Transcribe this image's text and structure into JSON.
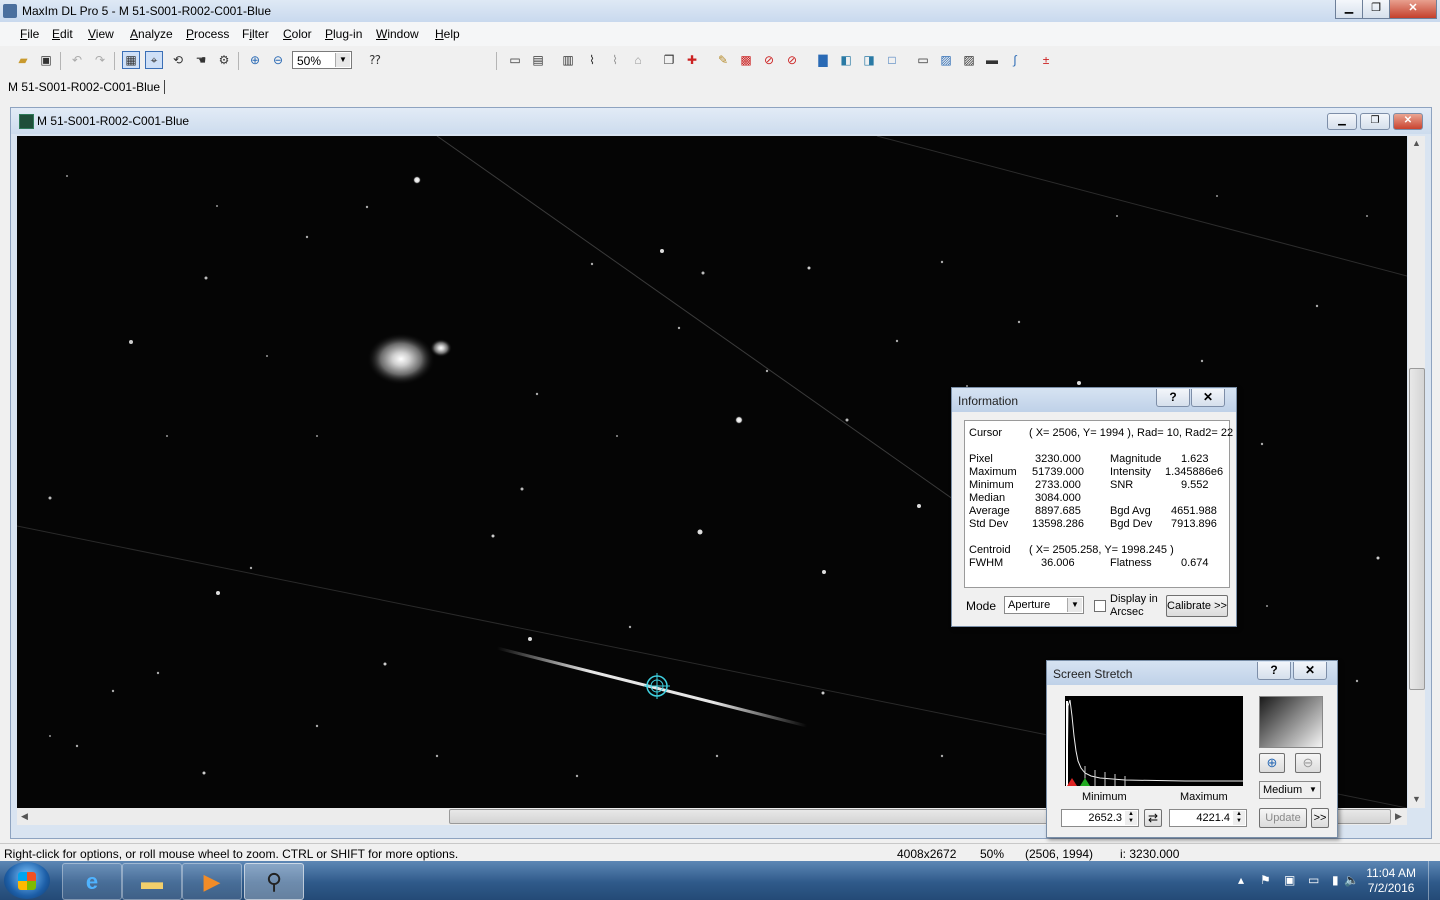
{
  "app": {
    "title": "MaxIm DL Pro 5 - M 51-S001-R002-C001-Blue"
  },
  "menu": [
    "File",
    "Edit",
    "View",
    "Analyze",
    "Process",
    "Filter",
    "Color",
    "Plug-in",
    "Window",
    "Help"
  ],
  "menu_mnemonics": [
    "F",
    "E",
    "V",
    "A",
    "P",
    "i",
    "C",
    "P",
    "W",
    "H"
  ],
  "toolbar": {
    "zoom_value": "50%"
  },
  "doc_tab": {
    "label": "M 51-S001-R002-C001-Blue"
  },
  "image_window": {
    "title": "M 51-S001-R002-C001-Blue"
  },
  "info": {
    "title": "Information",
    "help": "?",
    "close": "✕",
    "cursor_label": "Cursor",
    "cursor_value": "( X= 2506, Y= 1994 ), Rad= 10, Rad2= 22",
    "rows": [
      {
        "l1": "Pixel",
        "v1": "3230.000",
        "l2": "Magnitude",
        "v2": "1.623"
      },
      {
        "l1": "Maximum",
        "v1": "51739.000",
        "l2": "Intensity",
        "v2": "1.345886e6"
      },
      {
        "l1": "Minimum",
        "v1": "2733.000",
        "l2": "SNR",
        "v2": "9.552"
      },
      {
        "l1": "Median",
        "v1": "3084.000",
        "l2": "",
        "v2": ""
      },
      {
        "l1": "Average",
        "v1": "8897.685",
        "l2": "Bgd Avg",
        "v2": "4651.988"
      },
      {
        "l1": "Std Dev",
        "v1": "13598.286",
        "l2": "Bgd Dev",
        "v2": "7913.896"
      }
    ],
    "centroid_label": "Centroid",
    "centroid_value": "( X= 2505.258, Y= 1998.245 )",
    "fwhm_label": "FWHM",
    "fwhm_value": "36.006",
    "flatness_label": "Flatness",
    "flatness_value": "0.674",
    "mode_label": "Mode",
    "mode_value": "Aperture",
    "display_arcsec_label_1": "Display in",
    "display_arcsec_label_2": "Arcsec",
    "calibrate_label": "Calibrate >>"
  },
  "stretch": {
    "title": "Screen Stretch",
    "help": "?",
    "close": "✕",
    "minimum_label": "Minimum",
    "maximum_label": "Maximum",
    "minimum_value": "2652.3",
    "maximum_value": "4221.4",
    "preset_value": "Medium",
    "update_label": "Update",
    "more_label": ">>"
  },
  "status": {
    "hint": "Right-click for options, or roll mouse wheel to zoom. CTRL or SHIFT for more options.",
    "image_size": "4008x2672",
    "zoom": "50%",
    "coords": "(2506, 1994)",
    "intensity": "i:  3230.000"
  },
  "clock": {
    "time": "11:04 AM",
    "date": "7/2/2016"
  },
  "colors": {
    "accent": "#3b6fb6",
    "cursor_ring": "#3fd0e0"
  }
}
